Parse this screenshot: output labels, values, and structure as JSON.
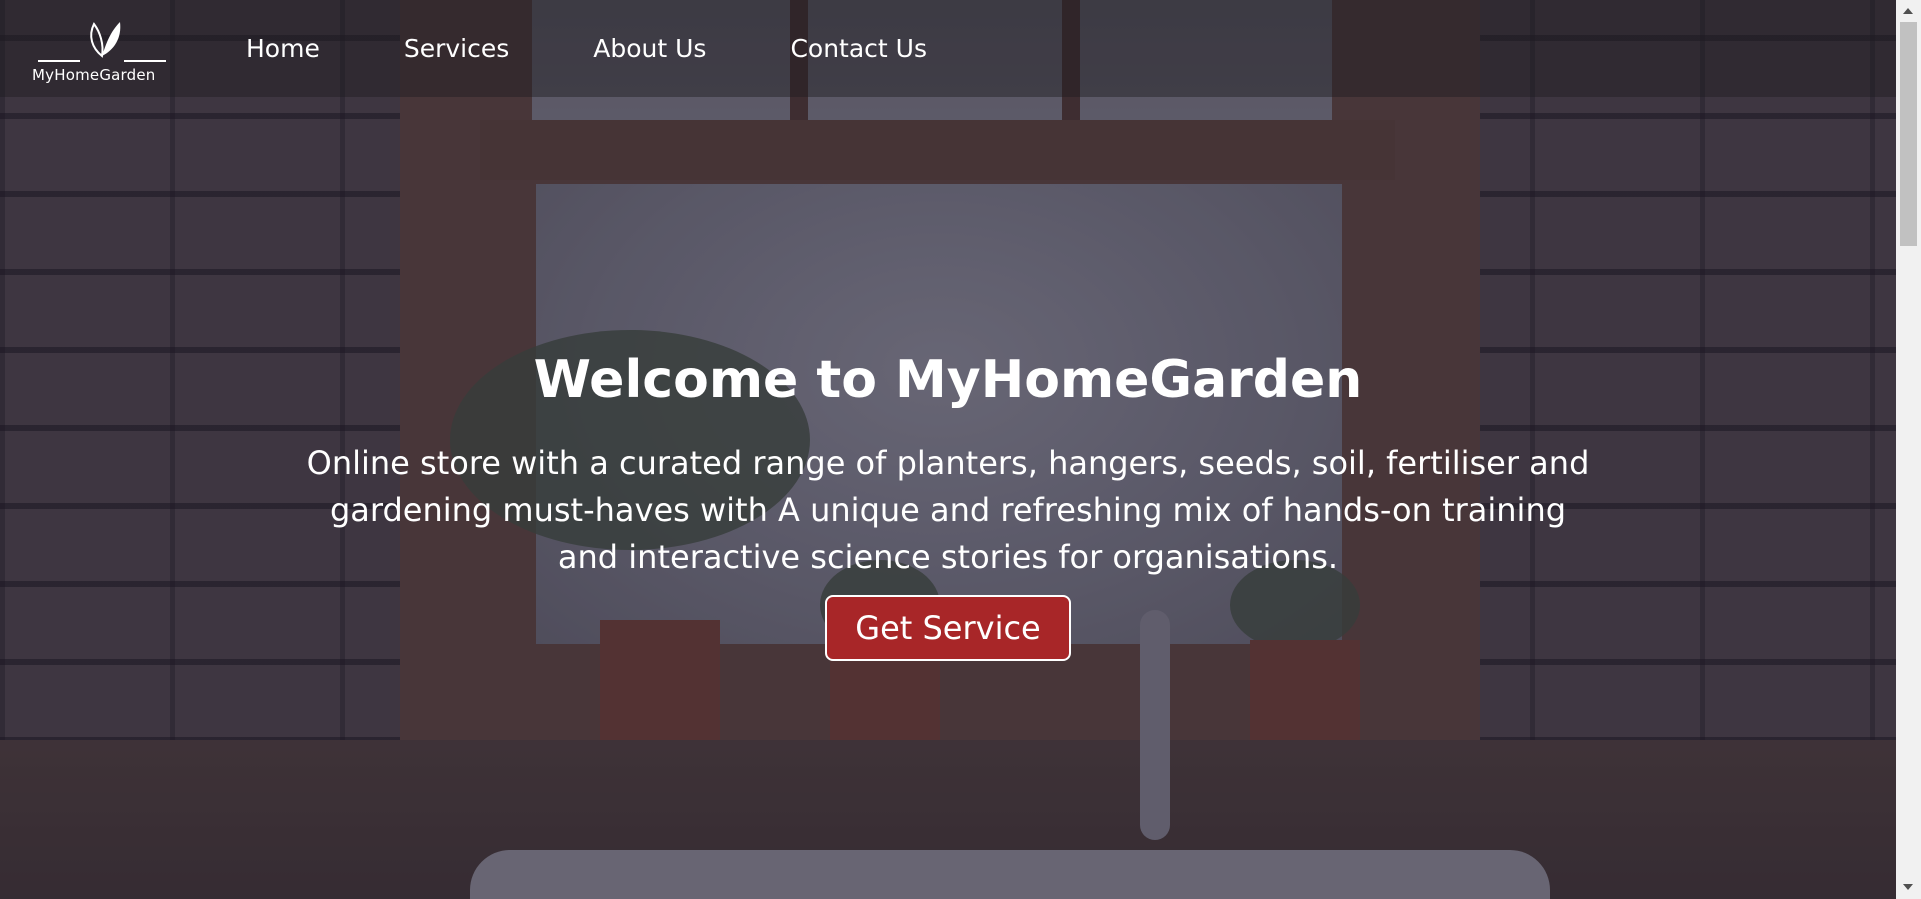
{
  "brand": {
    "logo_text": "MyHomeGarden",
    "logo_icon": "leaf-icon"
  },
  "nav": {
    "items": [
      {
        "label": "Home"
      },
      {
        "label": "Services"
      },
      {
        "label": "About Us"
      },
      {
        "label": "Contact Us"
      }
    ]
  },
  "hero": {
    "title": "Welcome to MyHomeGarden",
    "description": "Online store with a curated range of planters, hangers, seeds, soil, fertiliser and gardening must-haves with A unique and refreshing mix of hands-on training and interactive science stories for organisations.",
    "cta_label": "Get Service"
  },
  "colors": {
    "cta_background": "#a82628",
    "text": "#ffffff",
    "navbar_background": "#1e1c22"
  }
}
